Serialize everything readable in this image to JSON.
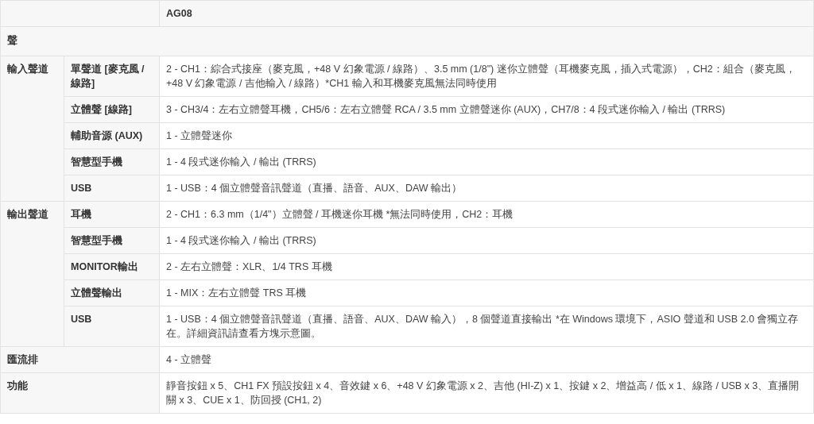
{
  "header": {
    "label": "AG08"
  },
  "section": {
    "label": "聲"
  },
  "groups": [
    {
      "label": "輸入聲道",
      "rows": [
        {
          "label": "單聲道 [麥克風 / 線路]",
          "value": "2 - CH1：綜合式接座（麥克風，+48 V 幻象電源 / 線路）、3.5 mm (1/8\") 迷你立體聲（耳機麥克風，插入式電源），CH2：組合（麥克風，+48 V 幻象電源 / 吉他輸入 / 線路）*CH1 輸入和耳機麥克風無法同時使用"
        },
        {
          "label": "立體聲 [線路]",
          "value": "3 - CH3/4：左右立體聲耳機，CH5/6：左右立體聲 RCA / 3.5 mm 立體聲迷你 (AUX)，CH7/8：4 段式迷你輸入 / 輸出 (TRRS)"
        },
        {
          "label": "輔助音源 (AUX)",
          "value": "1 - 立體聲迷你"
        },
        {
          "label": "智慧型手機",
          "value": "1 - 4 段式迷你輸入 / 輸出 (TRRS)"
        },
        {
          "label": "USB",
          "value": "1 - USB：4 個立體聲音訊聲道（直播、語音、AUX、DAW 輸出）"
        }
      ]
    },
    {
      "label": "輸出聲道",
      "rows": [
        {
          "label": "耳機",
          "value": "2 - CH1：6.3 mm（1/4\"）立體聲 / 耳機迷你耳機 *無法同時使用，CH2：耳機"
        },
        {
          "label": "智慧型手機",
          "value": "1 - 4 段式迷你輸入 / 輸出 (TRRS)"
        },
        {
          "label": "MONITOR輸出",
          "value": "2 - 左右立體聲：XLR、1/4 TRS 耳機"
        },
        {
          "label": "立體聲輸出",
          "value": "1 - MIX：左右立體聲 TRS 耳機"
        },
        {
          "label": "USB",
          "value": "1 - USB：4 個立體聲音訊聲道（直播、語音、AUX、DAW 輸入），8 個聲道直接輸出 *在 Windows 環境下，ASIO 聲道和 USB 2.0 會獨立存在。詳細資訊請查看方塊示意圖。"
        }
      ]
    }
  ],
  "rows": [
    {
      "label": "匯流排",
      "value": "4 - 立體聲"
    },
    {
      "label": "功能",
      "value": "靜音按鈕 x 5、CH1 FX 預設按鈕 x 4、音效鍵 x 6、+48 V 幻象電源 x 2、吉他 (HI-Z) x 1、按鍵 x 2、增益高 / 低 x 1、線路 / USB x 3、直播開關 x 3、CUE x 1、防回授 (CH1, 2)"
    }
  ]
}
